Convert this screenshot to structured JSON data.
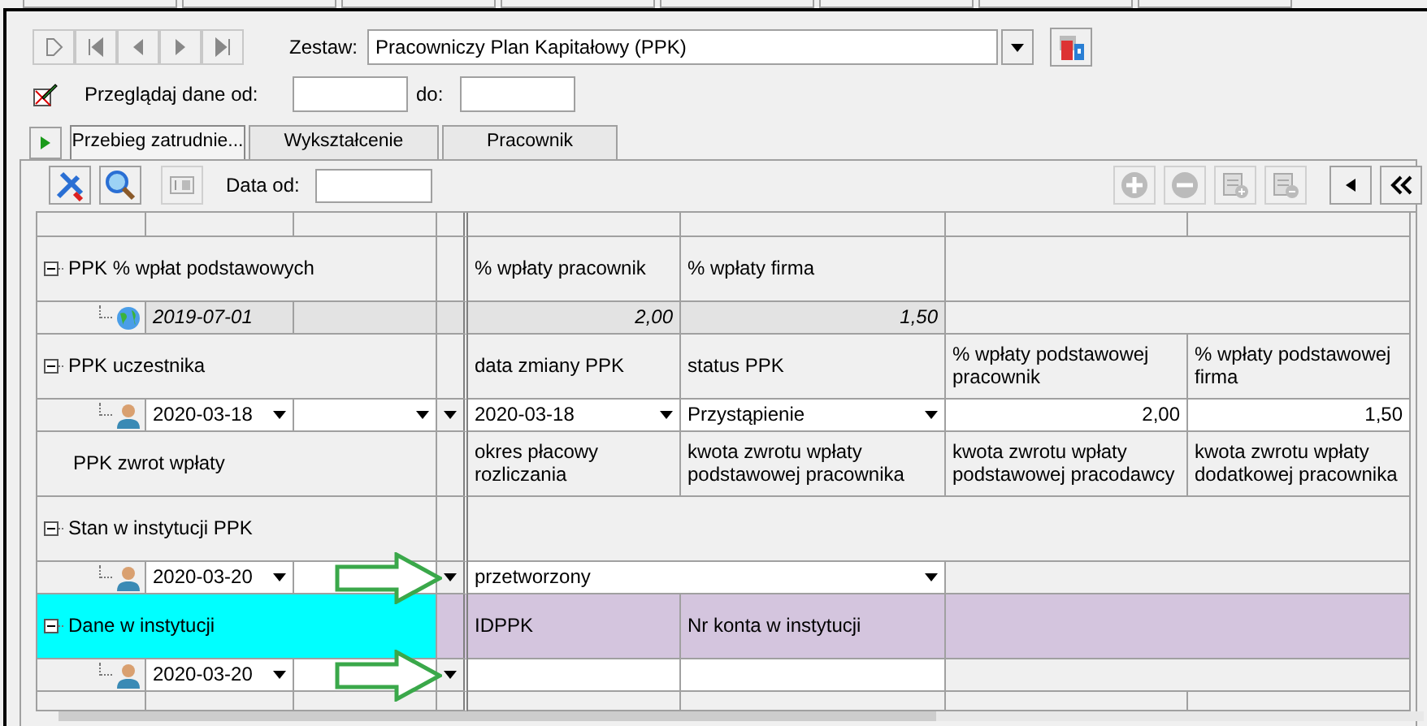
{
  "set_selector": {
    "label": "Zestaw:",
    "value": "Pracowniczy Plan Kapitałowy (PPK)"
  },
  "date_filter": {
    "label": "Przeglądaj dane od:",
    "to_label": "do:"
  },
  "tabs": [
    {
      "label": "Przebieg zatrudnie...",
      "selected": true
    },
    {
      "label": "Wykształcenie",
      "selected": false
    },
    {
      "label": "Pracownik",
      "selected": false
    }
  ],
  "toolbar": {
    "date_label": "Data od:"
  },
  "rows": [
    {
      "kind": "group",
      "label": "PPK % wpłat podstawowych",
      "expandable": true,
      "selected": false,
      "cells": [
        "% wpłaty pracownik",
        "% wpłaty firma"
      ]
    },
    {
      "kind": "default_record",
      "readonly": true,
      "annotated": false,
      "date": "2019-07-01",
      "cells": [
        {
          "kind": "number",
          "text": "2,00"
        },
        {
          "kind": "number",
          "text": "1,50"
        }
      ]
    },
    {
      "kind": "group",
      "label": "PPK uczestnika",
      "expandable": true,
      "selected": false,
      "cells": [
        "data zmiany PPK",
        "status PPK",
        "% wpłaty podstawowej pracownik",
        "% wpłaty podstawowej firma"
      ]
    },
    {
      "kind": "employee_record",
      "readonly": false,
      "annotated": false,
      "date": "2020-03-18",
      "cells": [
        {
          "kind": "combo",
          "text": "2020-03-18"
        },
        {
          "kind": "combo",
          "text": "Przystąpienie"
        },
        {
          "kind": "number",
          "text": "2,00"
        },
        {
          "kind": "number",
          "text": "1,50"
        }
      ]
    },
    {
      "kind": "group",
      "label": "PPK zwrot wpłaty",
      "expandable": false,
      "selected": false,
      "cells": [
        "okres płacowy rozliczania",
        "kwota zwrotu wpłaty podstawowej pracownika",
        "kwota zwrotu wpłaty podstawowej pracodawcy",
        "kwota zwrotu wpłaty dodatkowej pracownika"
      ]
    },
    {
      "kind": "group",
      "label": "Stan w instytucji PPK",
      "expandable": true,
      "selected": false,
      "cells": []
    },
    {
      "kind": "employee_record",
      "readonly": false,
      "annotated": true,
      "date": "2020-03-20",
      "cells": [
        {
          "kind": "wide_combo",
          "text": "przetworzony"
        }
      ]
    },
    {
      "kind": "group",
      "label": "Dane w instytucji",
      "expandable": true,
      "selected": true,
      "cells": [
        "IDPPK",
        "Nr konta w instytucji"
      ]
    },
    {
      "kind": "employee_record",
      "readonly": false,
      "annotated": true,
      "date": "2020-03-20",
      "cells": [
        {
          "kind": "blank"
        },
        {
          "kind": "blank"
        }
      ]
    }
  ]
}
